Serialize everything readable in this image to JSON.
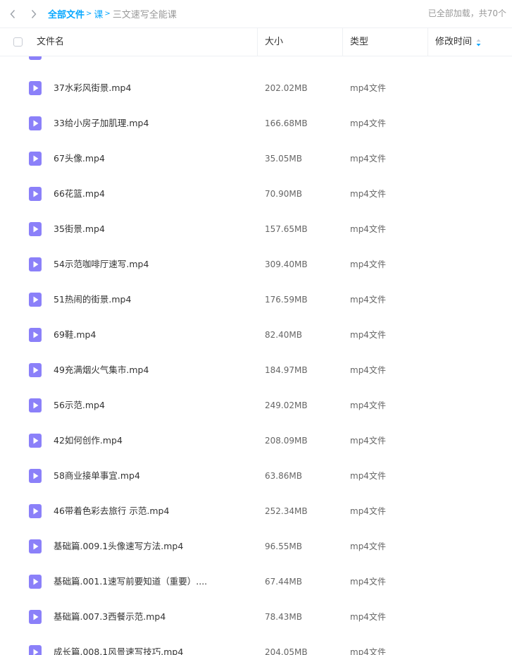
{
  "nav": {
    "back_icon": "chevron-left-icon",
    "forward_icon": "chevron-right-icon"
  },
  "breadcrumb": {
    "root": "全部文件",
    "sep": ">",
    "folder": "课",
    "current": "三文速写全能课"
  },
  "status_text": "已全部加载，共70个",
  "columns": {
    "name": "文件名",
    "size": "大小",
    "type": "类型",
    "mtime": "修改时间"
  },
  "colors": {
    "accent": "#06a7ff",
    "video_icon": "#8b80f9"
  },
  "files": [
    {
      "name": "",
      "size": "",
      "type": ""
    },
    {
      "name": "37水彩风街景.mp4",
      "size": "202.02MB",
      "type": "mp4文件"
    },
    {
      "name": "33给小房子加肌理.mp4",
      "size": "166.68MB",
      "type": "mp4文件"
    },
    {
      "name": "67头像.mp4",
      "size": "35.05MB",
      "type": "mp4文件"
    },
    {
      "name": "66花篮.mp4",
      "size": "70.90MB",
      "type": "mp4文件"
    },
    {
      "name": "35街景.mp4",
      "size": "157.65MB",
      "type": "mp4文件"
    },
    {
      "name": "54示范咖啡厅速写.mp4",
      "size": "309.40MB",
      "type": "mp4文件"
    },
    {
      "name": "51热闹的街景.mp4",
      "size": "176.59MB",
      "type": "mp4文件"
    },
    {
      "name": "69鞋.mp4",
      "size": "82.40MB",
      "type": "mp4文件"
    },
    {
      "name": "49充满烟火气集市.mp4",
      "size": "184.97MB",
      "type": "mp4文件"
    },
    {
      "name": "56示范.mp4",
      "size": "249.02MB",
      "type": "mp4文件"
    },
    {
      "name": "42如何创作.mp4",
      "size": "208.09MB",
      "type": "mp4文件"
    },
    {
      "name": "58商业接单事宜.mp4",
      "size": "63.86MB",
      "type": "mp4文件"
    },
    {
      "name": "46带着色彩去旅行 示范.mp4",
      "size": "252.34MB",
      "type": "mp4文件"
    },
    {
      "name": "基础篇.009.1头像速写方法.mp4",
      "size": "96.55MB",
      "type": "mp4文件"
    },
    {
      "name": "基础篇.001.1速写前要知道（重要）....",
      "size": "67.44MB",
      "type": "mp4文件"
    },
    {
      "name": "基础篇.007.3西餐示范.mp4",
      "size": "78.43MB",
      "type": "mp4文件"
    },
    {
      "name": "成长篇.008.1风景速写技巧.mp4",
      "size": "204.05MB",
      "type": "mp4文件"
    }
  ]
}
